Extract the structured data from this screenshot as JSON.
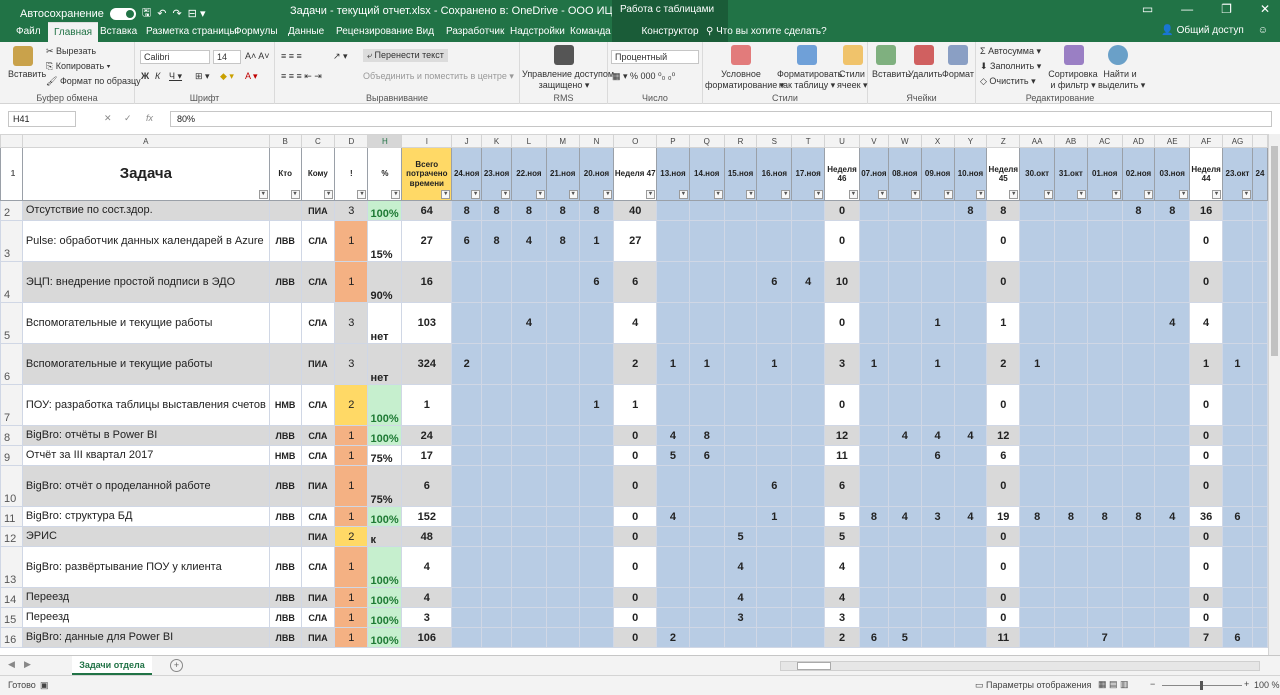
{
  "titlebar": {
    "autosave": "Автосохранение",
    "title": "Задачи - текущий отчет.xlsx  -  Сохранено в: OneDrive - ООО ИЦ АВИС  ▾",
    "context": "Работа с таблицами"
  },
  "tabs": [
    "Файл",
    "Главная",
    "Вставка",
    "Разметка страницы",
    "Формулы",
    "Данные",
    "Рецензирование",
    "Вид",
    "Разработчик",
    "Надстройки",
    "Команда",
    "Конструктор"
  ],
  "tab_search": "Что вы хотите сделать?",
  "share": "Общий доступ",
  "ribbon": {
    "paste": "Вставить",
    "cut": "Вырезать",
    "copy": "Копировать ▾",
    "format_painter": "Формат по образцу",
    "clipboard": "Буфер обмена",
    "font_name": "Calibri",
    "font_size": "14",
    "font_group": "Шрифт",
    "wrap": "Перенести текст",
    "merge": "Объединить и поместить в центре ▾",
    "align_group": "Выравнивание",
    "access": "Управление доступом",
    "access2": "защищено ▾",
    "rms": "RMS",
    "numfmt": "Процентный",
    "number_group": "Число",
    "cond": "Условное",
    "cond2": "форматирование ▾",
    "asTable": "Форматировать",
    "asTable2": "как таблицу ▾",
    "styles": "Стили",
    "styles2": "ячеек ▾",
    "styles_group": "Стили",
    "insert": "Вставить",
    "delete": "Удалить",
    "format": "Формат",
    "cells_group": "Ячейки",
    "autosum": "Автосумма ▾",
    "fill": "Заполнить ▾",
    "clear": "Очистить ▾",
    "sort": "Сортировка",
    "sort2": "и фильтр ▾",
    "find": "Найти и",
    "find2": "выделить ▾",
    "edit_group": "Редактирование"
  },
  "namebox": "H41",
  "formula": "80%",
  "columns": [
    "A",
    "B",
    "C",
    "D",
    "H",
    "I",
    "J",
    "K",
    "L",
    "M",
    "N",
    "O",
    "P",
    "Q",
    "R",
    "S",
    "T",
    "U",
    "V",
    "W",
    "X",
    "Y",
    "Z",
    "AA",
    "AB",
    "AC",
    "AD",
    "AE",
    "AF",
    "AG",
    ""
  ],
  "headers": [
    "Задача",
    "Кто",
    "Кому",
    "!",
    "%",
    "Всего потрачено времени",
    "24.ноя",
    "23.ноя",
    "22.ноя",
    "21.ноя",
    "20.ноя",
    "Неделя 47",
    "13.ноя",
    "14.ноя",
    "15.ноя",
    "16.ноя",
    "17.ноя",
    "Неделя 46",
    "07.ноя",
    "08.ноя",
    "09.ноя",
    "10.ноя",
    "Неделя 45",
    "30.окт",
    "31.окт",
    "01.ноя",
    "02.ноя",
    "03.ноя",
    "Неделя 44",
    "23.окт",
    "24"
  ],
  "rows": [
    {
      "n": "2",
      "cells": [
        "Отсутствие по сост.здор.",
        "",
        "ПИА",
        "3",
        "100%",
        "64",
        "8",
        "8",
        "8",
        "8",
        "8",
        "40",
        "",
        "",
        "",
        "",
        "",
        "0",
        "",
        "",
        "",
        "8",
        "8",
        "",
        "",
        "",
        "8",
        "8",
        "16",
        "",
        ""
      ],
      "tall": false,
      "gray": true
    },
    {
      "n": "3",
      "cells": [
        "Pulse: обработчик данных календарей в Azure",
        "ЛВВ",
        "СЛА",
        "1",
        "15%",
        "27",
        "6",
        "8",
        "4",
        "8",
        "1",
        "27",
        "",
        "",
        "",
        "",
        "",
        "0",
        "",
        "",
        "",
        "",
        "0",
        "",
        "",
        "",
        "",
        "",
        "0",
        "",
        ""
      ],
      "tall": true,
      "gray": false
    },
    {
      "n": "4",
      "cells": [
        "ЭЦП: внедрение простой подписи в ЭДО",
        "ЛВВ",
        "СЛА",
        "1",
        "90%",
        "16",
        "",
        "",
        "",
        "",
        "6",
        "6",
        "",
        "",
        "",
        "6",
        "4",
        "10",
        "",
        "",
        "",
        "",
        "0",
        "",
        "",
        "",
        "",
        "",
        "0",
        "",
        ""
      ],
      "tall": true,
      "gray": true
    },
    {
      "n": "5",
      "cells": [
        "Вспомогательные и текущие работы",
        "",
        "СЛА",
        "3",
        "нет",
        "103",
        "",
        "",
        "4",
        "",
        "",
        "4",
        "",
        "",
        "",
        "",
        "",
        "0",
        "",
        "",
        "1",
        "",
        "1",
        "",
        "",
        "",
        "",
        "4",
        "4",
        "",
        ""
      ],
      "tall": true,
      "gray": false
    },
    {
      "n": "6",
      "cells": [
        "Вспомогательные и текущие работы",
        "",
        "ПИА",
        "3",
        "нет",
        "324",
        "2",
        "",
        "",
        "",
        "",
        "2",
        "1",
        "1",
        "",
        "1",
        "",
        "3",
        "1",
        "",
        "1",
        "",
        "2",
        "1",
        "",
        "",
        "",
        "",
        "1",
        "1",
        ""
      ],
      "tall": true,
      "gray": true
    },
    {
      "n": "7",
      "cells": [
        "ПОУ: разработка таблицы выставления счетов",
        "НМВ",
        "СЛА",
        "2",
        "100%",
        "1",
        "",
        "",
        "",
        "",
        "1",
        "1",
        "",
        "",
        "",
        "",
        "",
        "0",
        "",
        "",
        "",
        "",
        "0",
        "",
        "",
        "",
        "",
        "",
        "0",
        "",
        ""
      ],
      "tall": true,
      "gray": false
    },
    {
      "n": "8",
      "cells": [
        "BigBro: отчёты в Power BI",
        "ЛВВ",
        "СЛА",
        "1",
        "100%",
        "24",
        "",
        "",
        "",
        "",
        "",
        "0",
        "4",
        "8",
        "",
        "",
        "",
        "12",
        "",
        "4",
        "4",
        "4",
        "12",
        "",
        "",
        "",
        "",
        "",
        "0",
        "",
        ""
      ],
      "tall": false,
      "gray": true
    },
    {
      "n": "9",
      "cells": [
        "Отчёт за III квартал 2017",
        "НМВ",
        "СЛА",
        "1",
        "75%",
        "17",
        "",
        "",
        "",
        "",
        "",
        "0",
        "5",
        "6",
        "",
        "",
        "",
        "11",
        "",
        "",
        "6",
        "",
        "6",
        "",
        "",
        "",
        "",
        "",
        "0",
        "",
        ""
      ],
      "tall": false,
      "gray": false
    },
    {
      "n": "10",
      "cells": [
        "BigBro: отчёт о проделанной работе",
        "ЛВВ",
        "ПИА",
        "1",
        "75%",
        "6",
        "",
        "",
        "",
        "",
        "",
        "0",
        "",
        "",
        "",
        "6",
        "",
        "6",
        "",
        "",
        "",
        "",
        "0",
        "",
        "",
        "",
        "",
        "",
        "0",
        "",
        ""
      ],
      "tall": true,
      "gray": true
    },
    {
      "n": "11",
      "cells": [
        "BigBro: структура БД",
        "ЛВВ",
        "СЛА",
        "1",
        "100%",
        "152",
        "",
        "",
        "",
        "",
        "",
        "0",
        "4",
        "",
        "",
        "1",
        "",
        "5",
        "8",
        "4",
        "3",
        "4",
        "19",
        "8",
        "8",
        "8",
        "8",
        "4",
        "36",
        "6",
        ""
      ],
      "tall": false,
      "gray": false
    },
    {
      "n": "12",
      "cells": [
        "ЭРИС",
        "",
        "ПИА",
        "2",
        "к",
        "48",
        "",
        "",
        "",
        "",
        "",
        "0",
        "",
        "",
        "5",
        "",
        "",
        "5",
        "",
        "",
        "",
        "",
        "0",
        "",
        "",
        "",
        "",
        "",
        "0",
        "",
        ""
      ],
      "tall": false,
      "gray": true
    },
    {
      "n": "13",
      "cells": [
        "BigBro: развёртывание ПОУ у клиента",
        "ЛВВ",
        "СЛА",
        "1",
        "100%",
        "4",
        "",
        "",
        "",
        "",
        "",
        "0",
        "",
        "",
        "4",
        "",
        "",
        "4",
        "",
        "",
        "",
        "",
        "0",
        "",
        "",
        "",
        "",
        "",
        "0",
        "",
        ""
      ],
      "tall": true,
      "gray": false
    },
    {
      "n": "14",
      "cells": [
        "Переезд",
        "ЛВВ",
        "ПИА",
        "1",
        "100%",
        "4",
        "",
        "",
        "",
        "",
        "",
        "0",
        "",
        "",
        "4",
        "",
        "",
        "4",
        "",
        "",
        "",
        "",
        "0",
        "",
        "",
        "",
        "",
        "",
        "0",
        "",
        ""
      ],
      "tall": false,
      "gray": true
    },
    {
      "n": "15",
      "cells": [
        "Переезд",
        "ЛВВ",
        "СЛА",
        "1",
        "100%",
        "3",
        "",
        "",
        "",
        "",
        "",
        "0",
        "",
        "",
        "3",
        "",
        "",
        "3",
        "",
        "",
        "",
        "",
        "0",
        "",
        "",
        "",
        "",
        "",
        "0",
        "",
        ""
      ],
      "tall": false,
      "gray": false
    },
    {
      "n": "16",
      "cells": [
        "BigBro: данные для Power BI",
        "ЛВВ",
        "ПИА",
        "1",
        "100%",
        "106",
        "",
        "",
        "",
        "",
        "",
        "0",
        "2",
        "",
        "",
        "",
        "",
        "2",
        "6",
        "5",
        "",
        "",
        "11",
        "",
        "",
        "7",
        "",
        "",
        "7",
        "6",
        ""
      ],
      "tall": false,
      "gray": true
    }
  ],
  "sheet_tab": "Задачи отдела",
  "status": {
    "ready": "Готово",
    "display": "Параметры отображения",
    "zoom": "100 %"
  },
  "colors": {
    "green": "#217346",
    "pri1": "#f4b183",
    "pri2": "#ffd966",
    "pri3": "#d9d9d9",
    "pctgood": "#c6efce",
    "totalhdr": "#ffd966",
    "blue": "#b8cce4"
  }
}
